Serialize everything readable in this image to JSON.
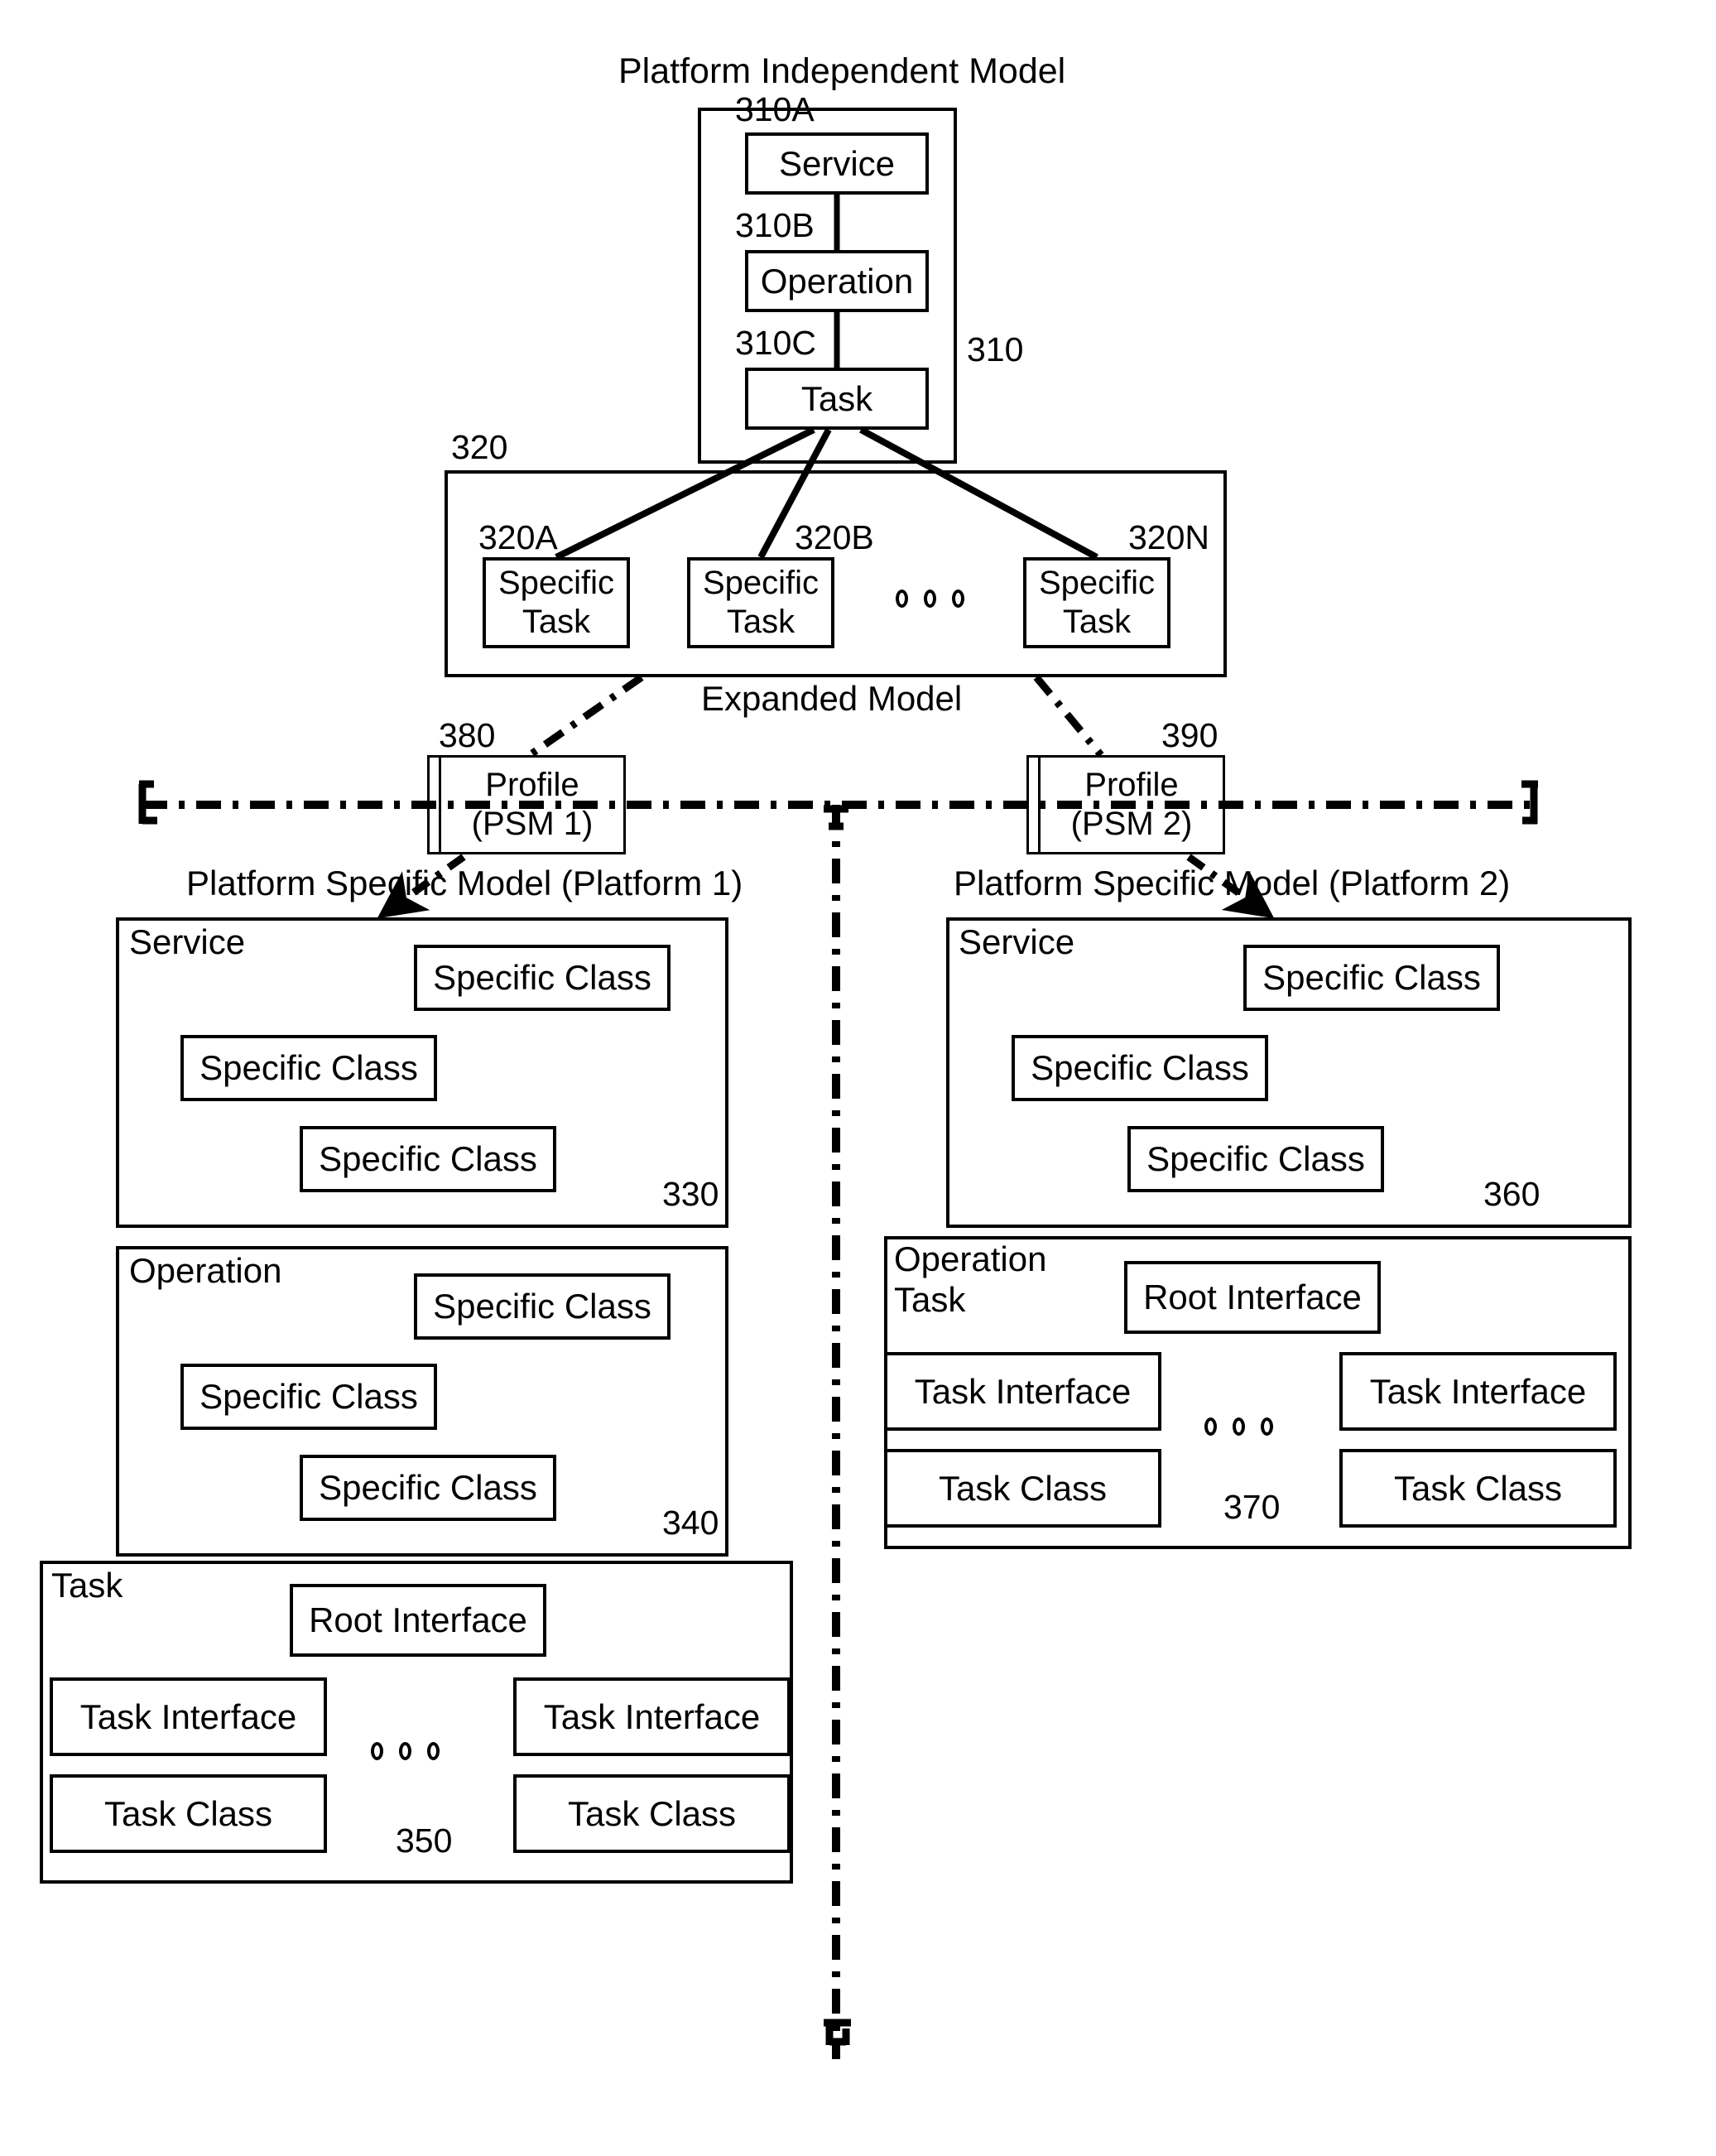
{
  "figure": {
    "pim_title": "Platform Independent Model",
    "expanded_model_label": "Expanded Model",
    "psm1_title": "Platform Specific Model (Platform 1)",
    "psm2_title": "Platform Specific Model (Platform 2)"
  },
  "pim": {
    "ref": "310",
    "nodes": [
      {
        "ref": "310A",
        "label": "Service"
      },
      {
        "ref": "310B",
        "label": "Operation"
      },
      {
        "ref": "310C",
        "label": "Task"
      }
    ]
  },
  "expanded": {
    "ref": "320",
    "tasks": [
      {
        "ref": "320A",
        "label": "Specific\nTask"
      },
      {
        "ref": "320B",
        "label": "Specific\nTask"
      },
      {
        "ref": "320N",
        "label": "Specific\nTask"
      }
    ],
    "ellipsis": "o o o"
  },
  "profiles": [
    {
      "ref": "380",
      "label": "Profile\n(PSM 1)"
    },
    {
      "ref": "390",
      "label": "Profile\n(PSM 2)"
    }
  ],
  "psm1": {
    "service": {
      "ref": "330",
      "title": "Service",
      "classes": [
        "Specific Class",
        "Specific Class",
        "Specific Class"
      ]
    },
    "operation": {
      "ref": "340",
      "title": "Operation",
      "classes": [
        "Specific Class",
        "Specific Class",
        "Specific Class"
      ]
    },
    "task": {
      "ref": "350",
      "title": "Task",
      "root_interface": "Root Interface",
      "interfaces": [
        "Task Interface",
        "Task Interface"
      ],
      "classes": [
        "Task Class",
        "Task Class"
      ]
    }
  },
  "psm2": {
    "service": {
      "ref": "360",
      "title": "Service",
      "classes": [
        "Specific Class",
        "Specific Class",
        "Specific Class"
      ]
    },
    "operation_task": {
      "ref": "370",
      "title": "Operation\nTask",
      "root_interface": "Root Interface",
      "interfaces": [
        "Task Interface",
        "Task Interface"
      ],
      "classes": [
        "Task Class",
        "Task Class"
      ]
    }
  },
  "colors": {
    "stroke": "#000000",
    "background": "#ffffff"
  }
}
